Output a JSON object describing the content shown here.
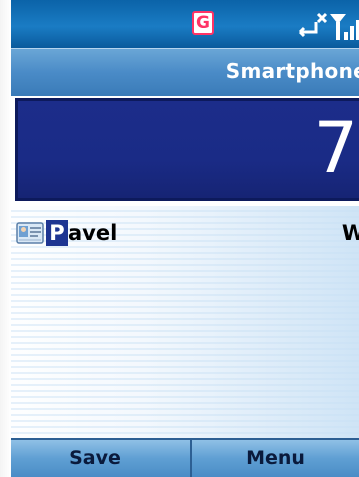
{
  "status_bar": {
    "connection_icon": "gprs-icon",
    "connection_glyph": "G",
    "signal_icon": "signal-strength-icon"
  },
  "title_bar": {
    "title": "Smartphone"
  },
  "number_display": {
    "value": "7"
  },
  "contact_list": {
    "items": [
      {
        "icon": "contact-card-icon",
        "highlighted_prefix": "P",
        "name_rest": "avel",
        "type_label": "W"
      }
    ]
  },
  "softkeys": {
    "left_label": "Save",
    "right_label": "Menu"
  },
  "colors": {
    "status_bar": "#1a7cc4",
    "title_bar": "#4a8bc7",
    "number_field": "#1c2d8a",
    "selection": "#1e3592",
    "softkey_bar": "#5f9fd3"
  }
}
